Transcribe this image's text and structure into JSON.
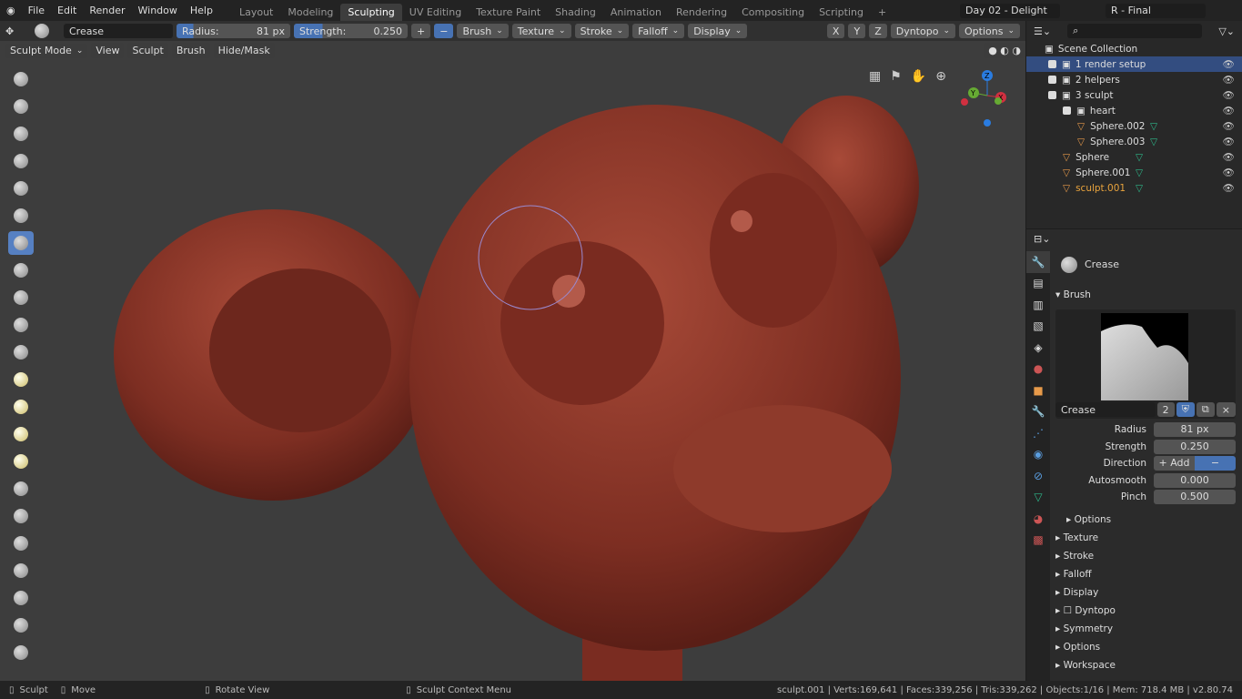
{
  "menu": [
    "File",
    "Edit",
    "Render",
    "Window",
    "Help"
  ],
  "workspaces": [
    "Layout",
    "Modeling",
    "Sculpting",
    "UV Editing",
    "Texture Paint",
    "Shading",
    "Animation",
    "Rendering",
    "Compositing",
    "Scripting"
  ],
  "active_workspace": "Sculpting",
  "scene": "Day 02 - Delight",
  "view_layer": "R - Final",
  "tool_header": {
    "brush": "Crease",
    "radius_label": "Radius:",
    "radius": "81 px",
    "strength_label": "Strength:",
    "strength": "0.250",
    "menus": [
      "Brush",
      "Texture",
      "Stroke",
      "Falloff",
      "Display"
    ],
    "axes": [
      "X",
      "Y",
      "Z"
    ],
    "dyntopo": "Dyntopo",
    "options": "Options"
  },
  "viewport_header": {
    "mode": "Sculpt Mode",
    "menus": [
      "View",
      "Sculpt",
      "Brush",
      "Hide/Mask"
    ]
  },
  "gizmo": {
    "x": "X",
    "y": "Y",
    "z": "Z"
  },
  "outliner": {
    "root": "Scene Collection",
    "items": [
      {
        "label": "1 render setup",
        "level": 0,
        "type": "collection",
        "selected": true
      },
      {
        "label": "2 helpers",
        "level": 0,
        "type": "collection"
      },
      {
        "label": "3 sculpt",
        "level": 0,
        "type": "collection"
      },
      {
        "label": "heart",
        "level": 1,
        "type": "collection"
      },
      {
        "label": "Sphere.002",
        "level": 2,
        "type": "mesh"
      },
      {
        "label": "Sphere.003",
        "level": 2,
        "type": "mesh"
      },
      {
        "label": "Sphere",
        "level": 1,
        "type": "mesh"
      },
      {
        "label": "Sphere.001",
        "level": 1,
        "type": "mesh"
      },
      {
        "label": "sculpt.001",
        "level": 1,
        "type": "mesh",
        "active": true
      }
    ]
  },
  "properties": {
    "tool_name": "Crease",
    "brush_panel": "Brush",
    "brush_name": "Crease",
    "users": "2",
    "fields": [
      {
        "label": "Radius",
        "value": "81 px",
        "fill": 0.15
      },
      {
        "label": "Strength",
        "value": "0.250",
        "fill": 0.25
      },
      {
        "label": "Autosmooth",
        "value": "0.000",
        "fill": 0
      },
      {
        "label": "Pinch",
        "value": "0.500",
        "fill": 0.5
      }
    ],
    "direction_label": "Direction",
    "direction_add": "+ Add",
    "direction_sub": "− Subtr..",
    "options": "Options",
    "sections": [
      "Texture",
      "Stroke",
      "Falloff",
      "Display",
      "Dyntopo",
      "Symmetry",
      "Options",
      "Workspace"
    ]
  },
  "status": {
    "left": "Sculpt",
    "middle": "Move",
    "rotate": "Rotate View",
    "context": "Sculpt Context Menu",
    "info": "sculpt.001 | Verts:169,641 | Faces:339,256 | Tris:339,262 | Objects:1/16 | Mem: 718.4 MB | v2.80.74"
  },
  "colors": {
    "accent": "#4772b3",
    "sculpt": "#8a3324",
    "background": "#3d3d3d"
  }
}
